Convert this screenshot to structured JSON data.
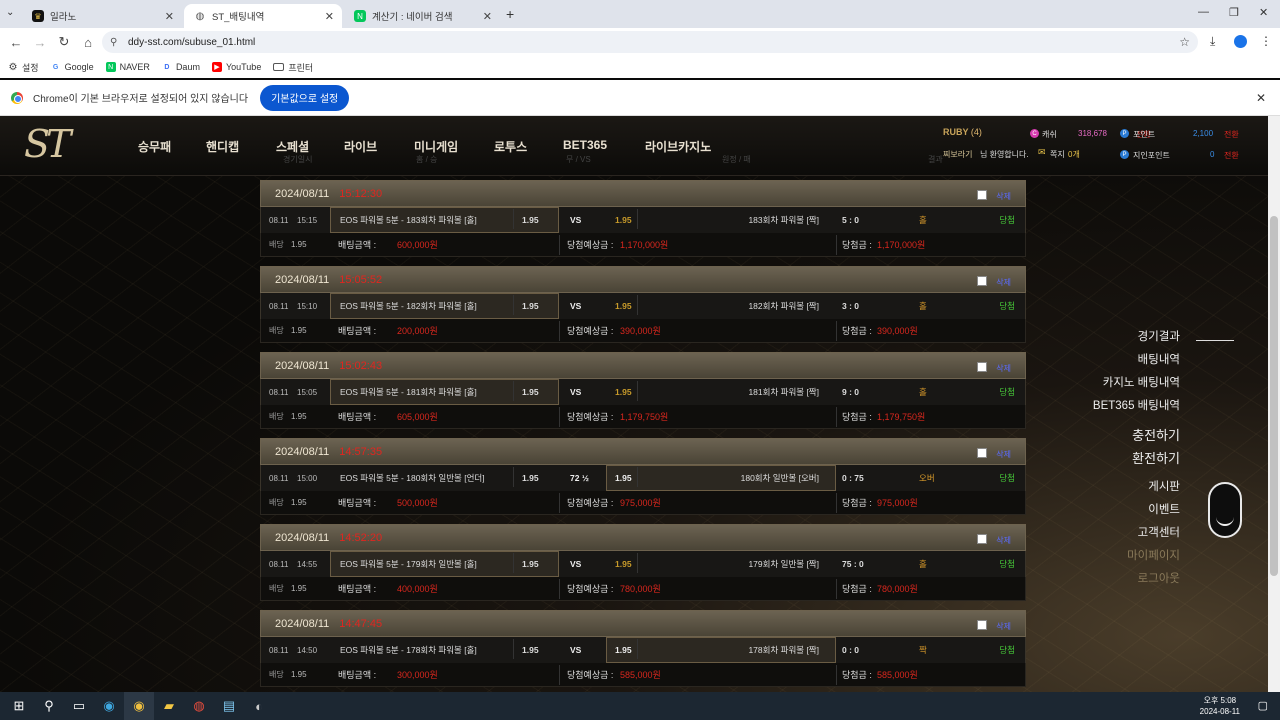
{
  "browser": {
    "tabs": [
      {
        "title": "일라노",
        "active": false
      },
      {
        "title": "ST_배팅내역",
        "active": true
      },
      {
        "title": "계산기 : 네이버 검색",
        "active": false
      }
    ],
    "url": "ddy-sst.com/subuse_01.html",
    "bookmarks": [
      "설정",
      "Google",
      "NAVER",
      "Daum",
      "YouTube",
      "프린터"
    ],
    "infobar": {
      "message": "Chrome이 기본 브라우저로 설정되어 있지 않습니다",
      "button": "기본값으로 설정"
    }
  },
  "site": {
    "logo": "ST",
    "nav": [
      "승무패",
      "핸디캡",
      "스페셜",
      "라이브",
      "미니게임",
      "로투스",
      "BET365",
      "라이브카지노"
    ],
    "user": {
      "rank": "RUBY",
      "rank_level": "(4)",
      "greeting_name": "찌보라기",
      "greeting_suffix": "님 환영합니다.",
      "message_label": "쪽지",
      "message_count": "0개",
      "cash_label": "캐쉬",
      "cash": "318,678",
      "cash_action": "전환",
      "point_label": "포인트",
      "point": "2,100",
      "point_action": "전환",
      "ref_label": "지인포인트",
      "ref_point": "0",
      "ref_action": "전환"
    },
    "header_ghost": [
      "경기일시",
      "홈 / 승",
      "무 / VS",
      "원정 / 패",
      "결과"
    ]
  },
  "bets": [
    {
      "date": "2024/08/11",
      "time": "15:12:30",
      "del": "삭제",
      "when": "08.11",
      "hm": "15:15",
      "home": "EOS 파워볼 5분 - 183회차 파워볼 [홀]",
      "home_odds": "1.95",
      "mid": "VS",
      "away_odds": "1.95",
      "away": "183회차 파워볼 [짝]",
      "score": "5 : 0",
      "res": "홀",
      "status": "당첨",
      "rate_label": "배당",
      "rate": "1.95",
      "amount_label": "배팅금액 :",
      "amount": "600,000원",
      "exp_label": "당첨예상금 :",
      "expected": "1,170,000원",
      "win_label": "당첨금 :",
      "win": "1,170,000원",
      "pick": "home"
    },
    {
      "date": "2024/08/11",
      "time": "15:05:52",
      "del": "삭제",
      "when": "08.11",
      "hm": "15:10",
      "home": "EOS 파워볼 5분 - 182회차 파워볼 [홀]",
      "home_odds": "1.95",
      "mid": "VS",
      "away_odds": "1.95",
      "away": "182회차 파워볼 [짝]",
      "score": "3 : 0",
      "res": "홀",
      "status": "당첨",
      "rate_label": "배당",
      "rate": "1.95",
      "amount_label": "배팅금액 :",
      "amount": "200,000원",
      "exp_label": "당첨예상금 :",
      "expected": "390,000원",
      "win_label": "당첨금 :",
      "win": "390,000원",
      "pick": "home"
    },
    {
      "date": "2024/08/11",
      "time": "15:02:43",
      "del": "삭제",
      "when": "08.11",
      "hm": "15:05",
      "home": "EOS 파워볼 5분 - 181회차 파워볼 [홀]",
      "home_odds": "1.95",
      "mid": "VS",
      "away_odds": "1.95",
      "away": "181회차 파워볼 [짝]",
      "score": "9 : 0",
      "res": "홀",
      "status": "당첨",
      "rate_label": "배당",
      "rate": "1.95",
      "amount_label": "배팅금액 :",
      "amount": "605,000원",
      "exp_label": "당첨예상금 :",
      "expected": "1,179,750원",
      "win_label": "당첨금 :",
      "win": "1,179,750원",
      "pick": "home"
    },
    {
      "date": "2024/08/11",
      "time": "14:57:35",
      "del": "삭제",
      "when": "08.11",
      "hm": "15:00",
      "home": "EOS 파워볼 5분 - 180회차 일반볼 [언더]",
      "home_odds": "1.95",
      "mid": "72 ½",
      "away_odds": "1.95",
      "away": "180회차 일반볼 [오버]",
      "score": "0 : 75",
      "res": "오버",
      "status": "당첨",
      "rate_label": "배당",
      "rate": "1.95",
      "amount_label": "배팅금액 :",
      "amount": "500,000원",
      "exp_label": "당첨예상금 :",
      "expected": "975,000원",
      "win_label": "당첨금 :",
      "win": "975,000원",
      "pick": "away"
    },
    {
      "date": "2024/08/11",
      "time": "14:52:20",
      "del": "삭제",
      "when": "08.11",
      "hm": "14:55",
      "home": "EOS 파워볼 5분 - 179회차 일반볼 [홀]",
      "home_odds": "1.95",
      "mid": "VS",
      "away_odds": "1.95",
      "away": "179회차 일반볼 [짝]",
      "score": "75 : 0",
      "res": "홀",
      "status": "당첨",
      "rate_label": "배당",
      "rate": "1.95",
      "amount_label": "배팅금액 :",
      "amount": "400,000원",
      "exp_label": "당첨예상금 :",
      "expected": "780,000원",
      "win_label": "당첨금 :",
      "win": "780,000원",
      "pick": "home"
    },
    {
      "date": "2024/08/11",
      "time": "14:47:45",
      "del": "삭제",
      "when": "08.11",
      "hm": "14:50",
      "home": "EOS 파워볼 5분 - 178회차 파워볼 [홀]",
      "home_odds": "1.95",
      "mid": "VS",
      "away_odds": "1.95",
      "away": "178회차 파워볼 [짝]",
      "score": "0 : 0",
      "res": "짝",
      "status": "당첨",
      "rate_label": "배당",
      "rate": "1.95",
      "amount_label": "배팅금액 :",
      "amount": "300,000원",
      "exp_label": "당첨예상금 :",
      "expected": "585,000원",
      "win_label": "당첨금 :",
      "win": "585,000원",
      "pick": "away"
    }
  ],
  "sidemenu": [
    "경기결과",
    "배팅내역",
    "카지노 배팅내역",
    "BET365 배팅내역",
    "충전하기",
    "환전하기",
    "게시판",
    "이벤트",
    "고객센터",
    "마이페이지",
    "로그아웃"
  ],
  "taskbar": {
    "time": "오후 5:08",
    "date": "2024-08-11"
  }
}
